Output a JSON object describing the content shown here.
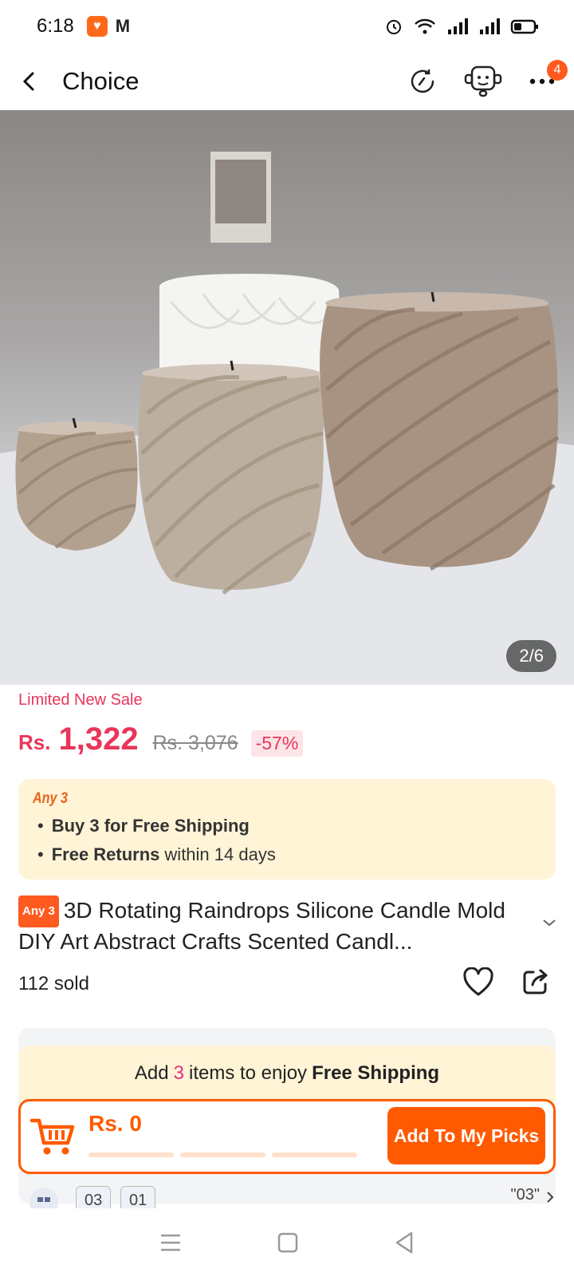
{
  "status_bar": {
    "time": "6:18"
  },
  "header": {
    "title": "Choice",
    "more_badge": "4"
  },
  "gallery": {
    "counter": "2/6"
  },
  "price": {
    "sale_label": "Limited New Sale",
    "currency": "Rs.",
    "current": "1,322",
    "original": "Rs. 3,076",
    "discount": "-57%"
  },
  "benefits": {
    "label": "Any 3",
    "shipping_bold": "Buy 3 for  Free Shipping",
    "returns_bold": "Free Returns",
    "returns_rest": "within 14 days"
  },
  "product": {
    "tag": "Any 3",
    "title": "3D Rotating Raindrops Silicone Candle Mold DIY Art Abstract Crafts Scented Candl...",
    "sold": "112 sold"
  },
  "promo": {
    "prefix": "Add",
    "count": "3",
    "middle": "items to enjoy",
    "bold": "Free Shipping"
  },
  "picks": {
    "price": "Rs. 0",
    "button_label": "Add To My Picks",
    "progress_filled": 0
  },
  "bottom_row": {
    "chip1": "03",
    "chip2": "01",
    "right_text": "\"03\""
  },
  "colors": {
    "accent": "#ff5a00",
    "price": "#e8365a",
    "banner_bg": "#fff4d6"
  }
}
